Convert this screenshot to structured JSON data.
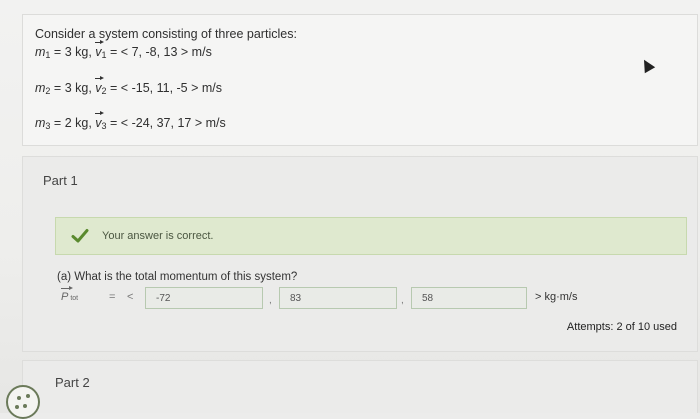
{
  "problem": {
    "intro": "Consider a system consisting of three particles:",
    "particles": [
      {
        "mass_var": "m",
        "mass_sub": "1",
        "mass_value": "= 3 kg,",
        "vel_var": "v",
        "vel_sub": "1",
        "vel_value": "= < 7, -8, 13 > m/s"
      },
      {
        "mass_var": "m",
        "mass_sub": "2",
        "mass_value": "= 3 kg,",
        "vel_var": "v",
        "vel_sub": "2",
        "vel_value": "= < -15, 11, -5 > m/s"
      },
      {
        "mass_var": "m",
        "mass_sub": "3",
        "mass_value": "= 2 kg,",
        "vel_var": "v",
        "vel_sub": "3",
        "vel_value": "= < -24, 37, 17 > m/s"
      }
    ]
  },
  "part1": {
    "title": "Part 1",
    "feedback": "Your answer is correct.",
    "question": "(a) What is the total momentum of this system?",
    "ptot_symbol": "P",
    "ptot_sub": "tot",
    "equals": "=",
    "open_bracket": "<",
    "answers": [
      "-72",
      "83",
      "58"
    ],
    "separator": ",",
    "unit": "> kg·m/s",
    "attempts": "Attempts: 2 of 10 used"
  },
  "part2": {
    "title": "Part 2"
  },
  "icons": {
    "check": "check-icon",
    "help": "help-icon"
  },
  "colors": {
    "correct_bg": "#dfe9cf",
    "check_green": "#5a8a2e"
  }
}
